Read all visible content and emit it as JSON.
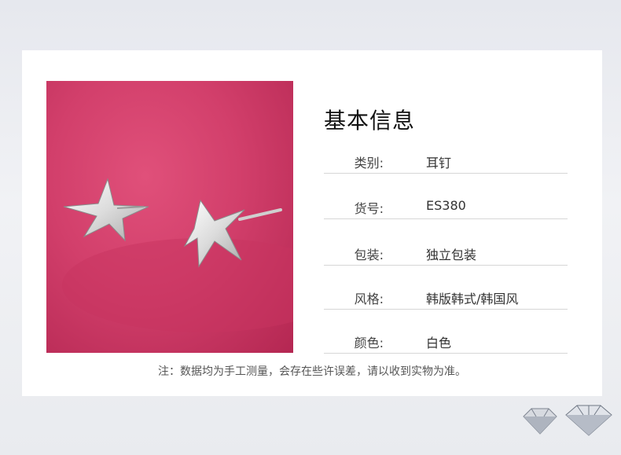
{
  "info": {
    "title": "基本信息",
    "rows": [
      {
        "label": "类别:",
        "value": "耳钉"
      },
      {
        "label": "货号:",
        "value": "ES380"
      },
      {
        "label": "包装:",
        "value": "独立包装"
      },
      {
        "label": "风格:",
        "value": "韩版韩式/韩国风"
      },
      {
        "label": "颜色:",
        "value": "白色"
      }
    ]
  },
  "note": "注：数据均为手工测量，会存在些许误差，请以收到实物为准。"
}
